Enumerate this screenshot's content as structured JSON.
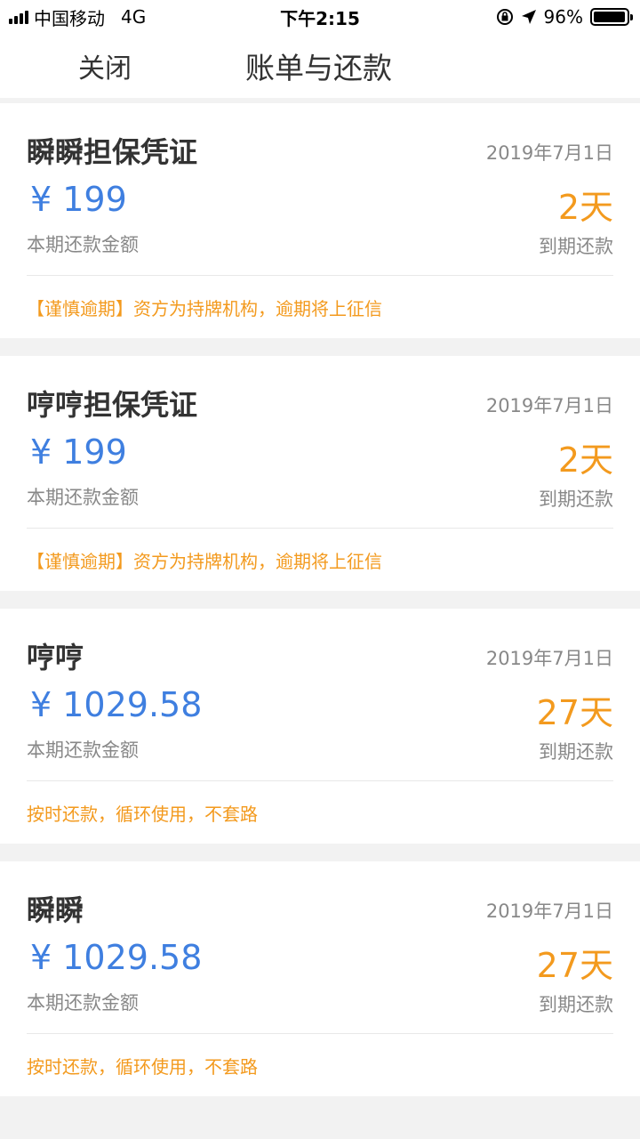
{
  "status_bar": {
    "carrier": "中国移动",
    "network": "4G",
    "time": "下午2:15",
    "battery_pct": "96%",
    "battery_level": 0.96,
    "icons": [
      "signal-icon",
      "rotation-lock-icon",
      "location-arrow-icon",
      "battery-icon"
    ]
  },
  "nav": {
    "close_label": "关闭",
    "title": "账单与还款"
  },
  "bills": [
    {
      "name": "瞬瞬担保凭证",
      "date": "2019年7月1日",
      "amount": "¥ 199",
      "amount_label": "本期还款金额",
      "days": "2天",
      "due_label": "到期还款",
      "note": "【谨慎逾期】资方为持牌机构，逾期将上征信"
    },
    {
      "name": "哼哼担保凭证",
      "date": "2019年7月1日",
      "amount": "¥ 199",
      "amount_label": "本期还款金额",
      "days": "2天",
      "due_label": "到期还款",
      "note": "【谨慎逾期】资方为持牌机构，逾期将上征信"
    },
    {
      "name": "哼哼",
      "date": "2019年7月1日",
      "amount": "¥ 1029.58",
      "amount_label": "本期还款金额",
      "days": "27天",
      "due_label": "到期还款",
      "note": "按时还款，循环使用，不套路"
    },
    {
      "name": "瞬瞬",
      "date": "2019年7月1日",
      "amount": "¥ 1029.58",
      "amount_label": "本期还款金额",
      "days": "27天",
      "due_label": "到期还款",
      "note": "按时还款，循环使用，不套路"
    }
  ],
  "colors": {
    "amount": "#3f7fe0",
    "accent": "#f39a1e"
  }
}
